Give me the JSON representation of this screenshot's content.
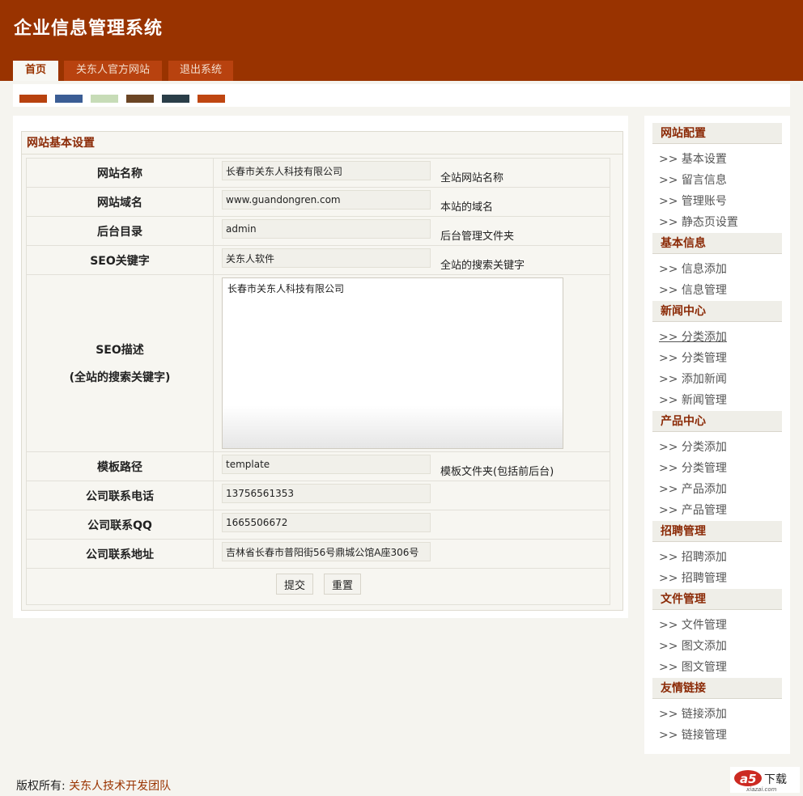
{
  "header": {
    "app_title": "企业信息管理系统",
    "tabs": [
      {
        "label": "首页",
        "active": true
      },
      {
        "label": "关东人官方网站",
        "active": false
      },
      {
        "label": "退出系统",
        "active": false
      }
    ]
  },
  "theme_swatches": [
    "#b8420f",
    "#3b5d95",
    "#c7dcb7",
    "#6b4524",
    "#2a3e48",
    "#bf4611"
  ],
  "main": {
    "panel_title": "网站基本设置",
    "fields": {
      "site_name": {
        "label": "网站名称",
        "value": "长春市关东人科技有限公司",
        "hint": "全站网站名称"
      },
      "site_domain": {
        "label": "网站域名",
        "value": "www.guandongren.com",
        "hint": "本站的域名"
      },
      "admin_dir": {
        "label": "后台目录",
        "value": "admin",
        "hint": "后台管理文件夹"
      },
      "seo_keywords": {
        "label": "SEO关键字",
        "value": "关东人软件",
        "hint": "全站的搜索关键字"
      },
      "seo_description": {
        "label": "SEO描述",
        "sublabel": "(全站的搜索关键字)",
        "value": "长春市关东人科技有限公司"
      },
      "template_path": {
        "label": "模板路径",
        "value": "template",
        "hint": "模板文件夹(包括前后台)"
      },
      "company_phone": {
        "label": "公司联系电话",
        "value": "13756561353"
      },
      "company_qq": {
        "label": "公司联系QQ",
        "value": "1665506672"
      },
      "company_address": {
        "label": "公司联系地址",
        "value": "吉林省长春市普阳街56号鼎城公馆A座306号"
      }
    },
    "buttons": {
      "submit": "提交",
      "reset": "重置"
    }
  },
  "sidebar": {
    "sections": [
      {
        "title": "网站配置",
        "links": [
          ">> 基本设置",
          ">> 留言信息",
          ">> 管理账号",
          ">> 静态页设置"
        ]
      },
      {
        "title": "基本信息",
        "links": [
          ">> 信息添加",
          ">> 信息管理"
        ]
      },
      {
        "title": "新闻中心",
        "links": [
          ">> 分类添加",
          ">> 分类管理",
          ">> 添加新闻",
          ">> 新闻管理"
        ]
      },
      {
        "title": "产品中心",
        "links": [
          ">> 分类添加",
          ">> 分类管理",
          ">> 产品添加",
          ">> 产品管理"
        ]
      },
      {
        "title": "招聘管理",
        "links": [
          ">> 招聘添加",
          ">> 招聘管理"
        ]
      },
      {
        "title": "文件管理",
        "links": [
          ">> 文件管理",
          ">> 图文添加",
          ">> 图文管理"
        ]
      },
      {
        "title": "友情链接",
        "links": [
          ">> 链接添加",
          ">> 链接管理"
        ]
      }
    ]
  },
  "footer": {
    "copyright_label": "版权所有:",
    "team_name": "关东人技术开发团队",
    "logo_mark": "a5",
    "logo_text": "下载",
    "logo_url": "xiazai.com"
  }
}
